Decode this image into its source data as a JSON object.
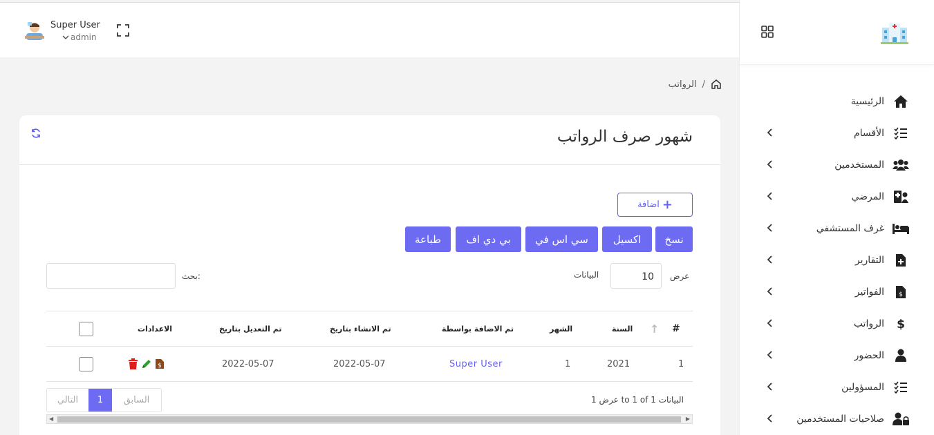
{
  "topbar": {
    "user_name": "Super User",
    "user_role": "admin"
  },
  "breadcrumb": {
    "current": "الرواتب",
    "separator": "/"
  },
  "sidebar": {
    "items": [
      {
        "label": "الرئيسية",
        "icon": "home-icon",
        "has_submenu": false
      },
      {
        "label": "الأقسام",
        "icon": "list-check-icon",
        "has_submenu": true
      },
      {
        "label": "المستخدمين",
        "icon": "users-icon",
        "has_submenu": true
      },
      {
        "label": "المرضي",
        "icon": "patient-card-icon",
        "has_submenu": true
      },
      {
        "label": "غرف المستشفي",
        "icon": "bed-icon",
        "has_submenu": true
      },
      {
        "label": "التقارير",
        "icon": "file-medical-icon",
        "has_submenu": true
      },
      {
        "label": "الفواتير",
        "icon": "invoice-icon",
        "has_submenu": true
      },
      {
        "label": "الرواتب",
        "icon": "dollar-icon",
        "has_submenu": true
      },
      {
        "label": "الحضور",
        "icon": "user-icon",
        "has_submenu": true
      },
      {
        "label": "المسؤولين",
        "icon": "list-check-icon",
        "has_submenu": true
      },
      {
        "label": "صلاحيات المستخدمين",
        "icon": "user-lock-icon",
        "has_submenu": true
      }
    ]
  },
  "card": {
    "title": "شهور صرف الرواتب",
    "add_label": "اضافة",
    "export_buttons": [
      "نسخ",
      "اكسيل",
      "سي اس في",
      "بي دي اف",
      "طباعة"
    ],
    "length_label_before": "عرض",
    "length_value": "10",
    "length_label_after": "البيانات",
    "search_label": "بحث:",
    "search_value": "",
    "table": {
      "headers": [
        "#",
        "السنة",
        "الشهر",
        "تم الاضافة بواسطة",
        "تم الانشاء بتاريخ",
        "تم التعديل بتاريخ",
        "الاعدادات"
      ],
      "rows": [
        {
          "num": "1",
          "year": "2021",
          "month": "1",
          "added_by": "Super User",
          "created_at": "2022-05-07",
          "updated_at": "2022-05-07"
        }
      ]
    },
    "info": "عرض 1 to 1 of 1 البيانات",
    "pager": {
      "prev": "السابق",
      "page": "1",
      "next": "التالي"
    }
  },
  "colors": {
    "accent": "#6d6bf2",
    "delete": "#e01b1b",
    "edit": "#2e9e2e",
    "invoice": "#8b4a1e"
  }
}
